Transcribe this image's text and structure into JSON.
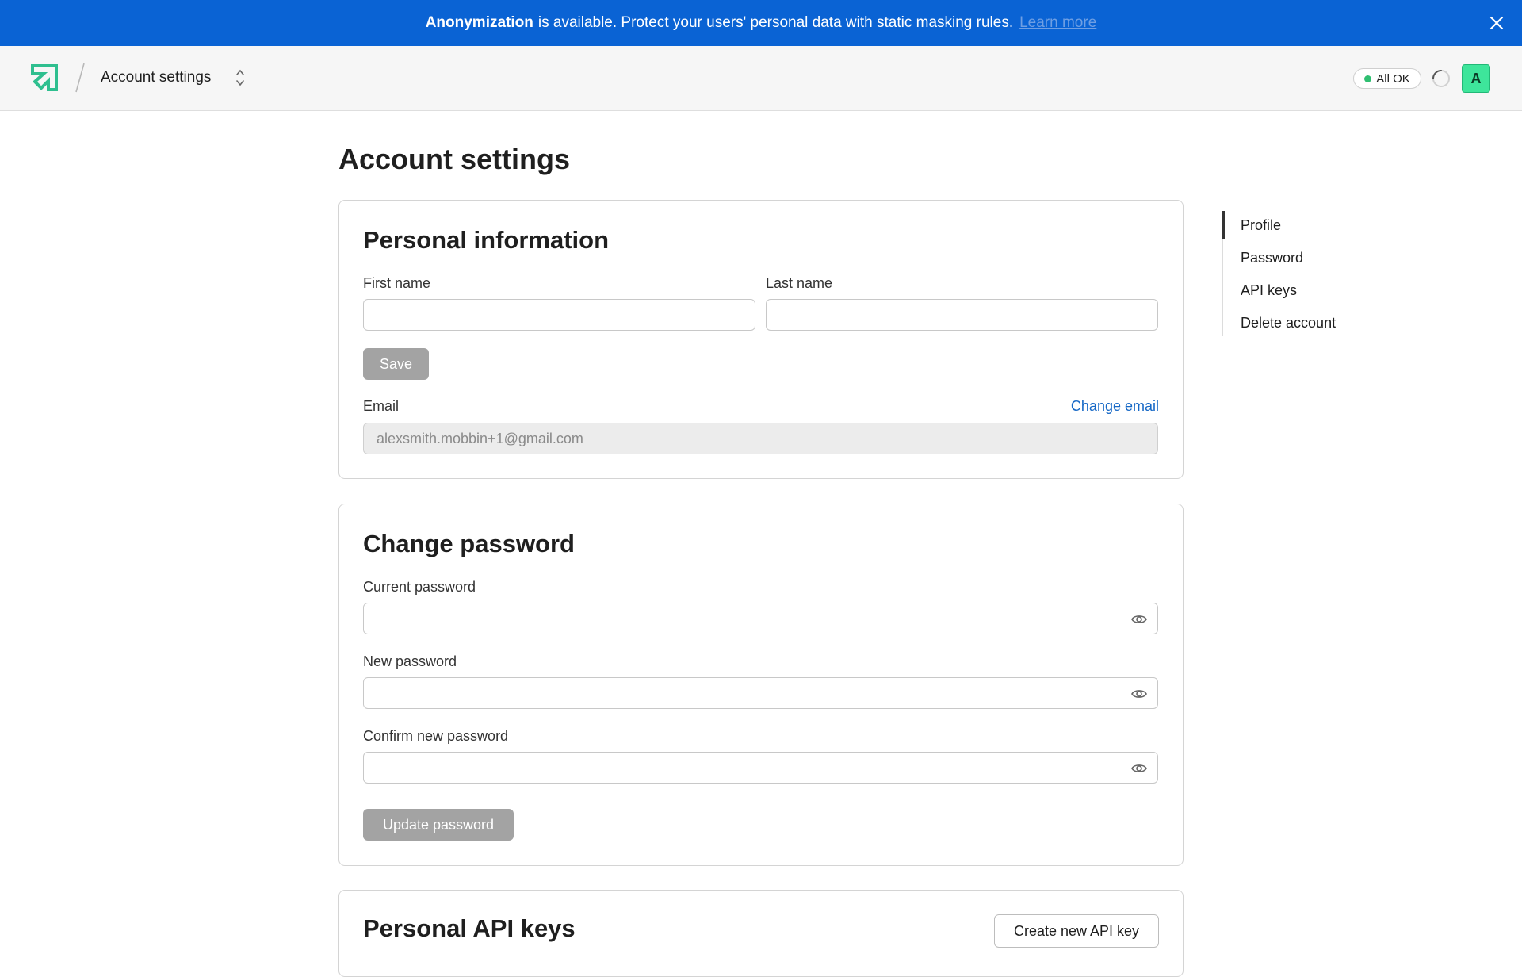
{
  "banner": {
    "bold_text": "Anonymization",
    "text": "is available. Protect your users' personal data with static masking rules.",
    "link_text": "Learn more"
  },
  "header": {
    "breadcrumb": "Account settings",
    "status": "All OK",
    "avatar_initial": "A"
  },
  "page": {
    "title": "Account settings"
  },
  "personal_info": {
    "title": "Personal information",
    "first_name_label": "First name",
    "first_name_value": "",
    "last_name_label": "Last name",
    "last_name_value": "",
    "save_label": "Save",
    "email_label": "Email",
    "change_email_label": "Change email",
    "email_value": "alexsmith.mobbin+1@gmail.com"
  },
  "change_password": {
    "title": "Change password",
    "current_label": "Current password",
    "new_label": "New password",
    "confirm_label": "Confirm new password",
    "update_label": "Update password"
  },
  "api_keys": {
    "title": "Personal API keys",
    "create_label": "Create new API key"
  },
  "side_nav": {
    "items": [
      {
        "label": "Profile"
      },
      {
        "label": "Password"
      },
      {
        "label": "API keys"
      },
      {
        "label": "Delete account"
      }
    ]
  },
  "colors": {
    "banner": "#0a63d4",
    "logo": "#2fbf8f",
    "status_ok": "#2fbf71",
    "avatar": "#3ee59b",
    "link": "#1668c6"
  },
  "icons": {
    "close": "close-icon",
    "logo": "logo-icon",
    "switcher": "chevron-up-down-icon",
    "spinner": "loading-spinner-icon",
    "password_toggle": "eye-icon"
  }
}
